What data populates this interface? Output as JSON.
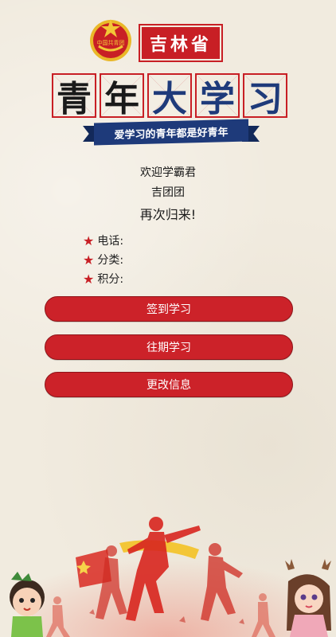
{
  "header": {
    "emblem_text": "中国共青团",
    "province": "吉林省",
    "title_chars": [
      "青",
      "年",
      "大",
      "学",
      "习"
    ],
    "slogan": "爱学习的青年都是好青年"
  },
  "welcome": {
    "line1": "欢迎学霸君",
    "name": "吉团团",
    "line3": "再次归来!"
  },
  "info": {
    "phone_label": "电话:",
    "category_label": "分类:",
    "points_label": "积分:"
  },
  "buttons": {
    "checkin": "签到学习",
    "past": "往期学习",
    "edit": "更改信息"
  },
  "colors": {
    "red": "#c81f25",
    "blue": "#1e3a7a",
    "background": "#f1ebdf"
  }
}
